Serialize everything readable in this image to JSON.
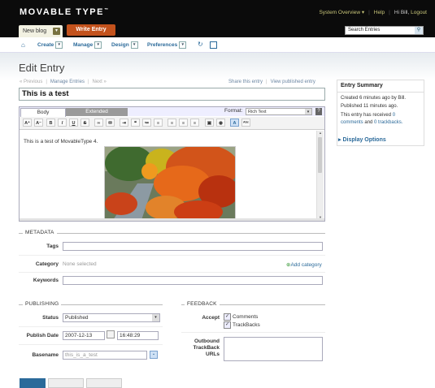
{
  "header": {
    "logo": "MOVABLE TYPE",
    "logo_tm": "™",
    "system_overview": "System Overview ▾",
    "help": "Help",
    "greeting": "Hi Bill,",
    "logout": "Logout",
    "blog_switcher": "New blog",
    "write_entry": "Write Entry",
    "search_value": "Search Entries"
  },
  "nav": {
    "create": "Create",
    "manage": "Manage",
    "design": "Design",
    "preferences": "Preferences"
  },
  "page": {
    "title": "Edit Entry",
    "prev": "« Previous",
    "manage_entries": "Manage Entries",
    "next": "Next »",
    "share": "Share this entry",
    "view_published": "View published entry"
  },
  "entry": {
    "title_value": "This is a test",
    "tab_body": "Body",
    "tab_extended": "Extended",
    "format_label": "Format:",
    "format_value": "Rich Text",
    "body_text": "This is a test of MovableType 4."
  },
  "summary": {
    "heading": "Entry Summary",
    "created": "Created 6 minutes ago by Bill.",
    "published": "Published 11 minutes ago.",
    "received_prefix": "This entry has received",
    "comments_count": "0",
    "comments_word": "comments",
    "and": "and",
    "trackbacks": "0 trackbacks.",
    "display_options": "▸ Display Options"
  },
  "metadata": {
    "heading": "METADATA",
    "tags_label": "Tags",
    "category_label": "Category",
    "category_value": "None selected",
    "add_category": "Add category",
    "keywords_label": "Keywords"
  },
  "publishing": {
    "heading": "PUBLISHING",
    "status_label": "Status",
    "status_value": "Published",
    "publish_date_label": "Publish Date",
    "date_value": "2007-12-13",
    "time_value": "16:48:29",
    "basename_label": "Basename",
    "basename_value": "this_is_a_test"
  },
  "feedback": {
    "heading": "FEEDBACK",
    "accept_label": "Accept",
    "comments": "Comments",
    "trackbacks": "TrackBacks",
    "outbound_l1": "Outbound",
    "outbound_l2": "TrackBack",
    "outbound_l3": "URLs"
  }
}
